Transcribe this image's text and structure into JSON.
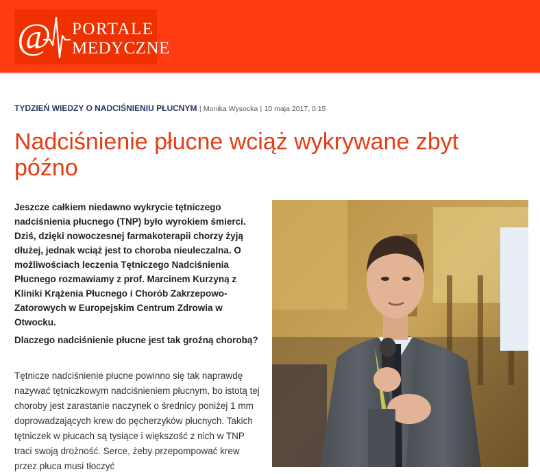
{
  "logo": {
    "symbol": "@",
    "line1": "PORTALE",
    "line2": "MEDYCZNE"
  },
  "article": {
    "category": "TYDZIEŃ WIEDZY O NADCIŚNIENIU PŁUCNYM",
    "separator1": "|",
    "author": "Monika Wysocka",
    "separator2": "|",
    "date": "10 maja 2017, 0:15",
    "title": "Nadciśnienie płucne wciąż wykrywane zbyt późno",
    "lead": "Jeszcze całkiem niedawno wykrycie tętniczego nadciśnienia płucnego (TNP) było wyrokiem śmierci. Dziś, dzięki nowoczesnej farmakoterapii chorzy żyją dłużej, jednak wciąż jest to choroba nieuleczalna. O możliwościach leczenia Tętniczego Nadciśnienia Płucnego rozmawiamy z prof. Marcinem Kurzyną z Kliniki Krążenia Płucnego i Chorób Zakrzepowo-Zatorowych w Europejskim Centrum Zdrowia w Otwocku.",
    "question": "Dlaczego nadciśnienie płucne jest tak groźną chorobą?",
    "answer": "Tętnicze nadciśnienie płucne powinno się tak naprawdę nazywać tętniczkowym nadciśnieniem płucnym, bo istotą tej choroby jest zarastanie naczynek o średnicy poniżej 1 mm doprowadzających krew do pęcherzyków płucnych. Takich tętniczek w płucach są tysiące i większość z nich w TNP traci swoją drożność. Serce, żeby przepompować krew przez płuca musi tłoczyć"
  },
  "colors": {
    "header": "#ff3b12",
    "title": "#e43c15",
    "category": "#2a3560"
  },
  "icons": {
    "logo_mark": "heartbeat-icon"
  }
}
